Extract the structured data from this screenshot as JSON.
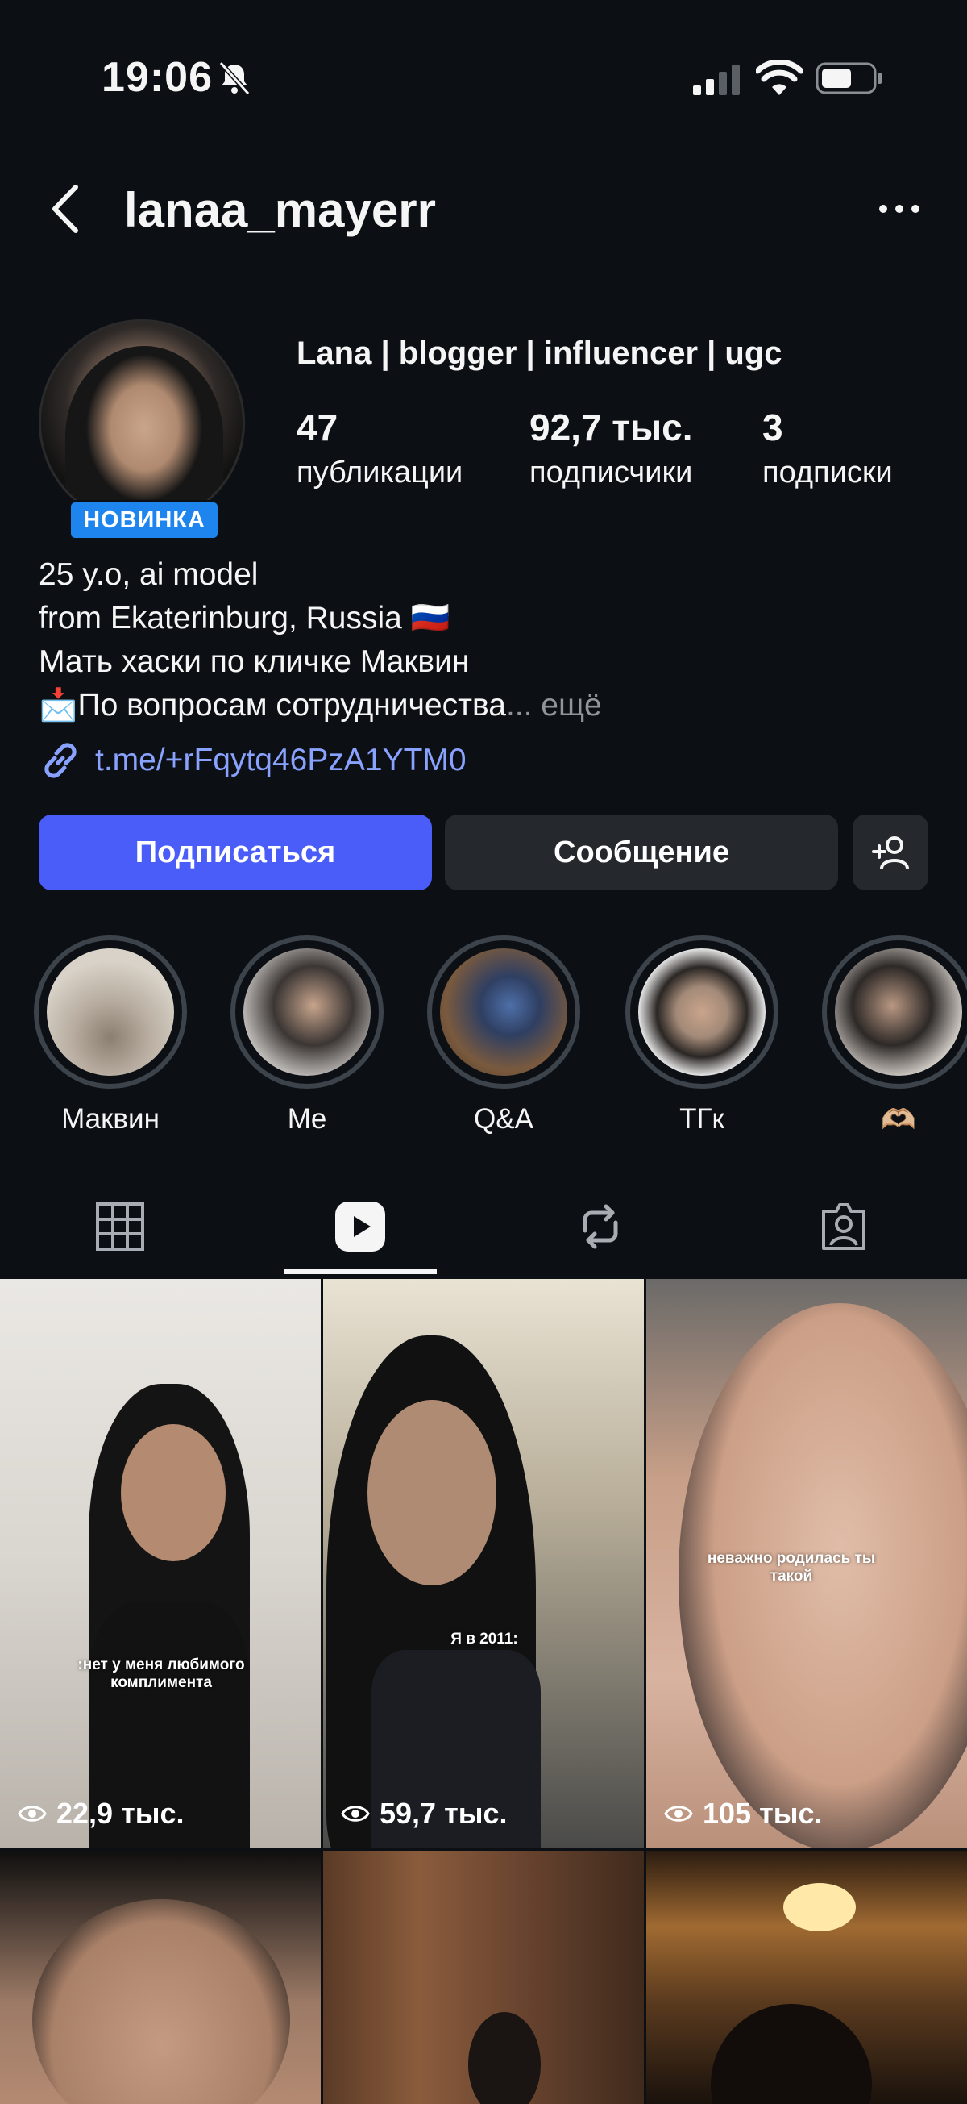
{
  "status_bar": {
    "time": "19:06"
  },
  "header": {
    "username": "lanaa_mayerr"
  },
  "profile": {
    "badge": "НОВИНКА",
    "display_name": "Lana | blogger | influencer | ugc",
    "stats": [
      {
        "value": "47",
        "label": "публикации"
      },
      {
        "value": "92,7 тыс.",
        "label": "подписчики"
      },
      {
        "value": "3",
        "label": "подписки"
      }
    ],
    "bio": {
      "line1": "25 y.o, ai model",
      "line2": "from Ekaterinburg, Russia 🇷🇺",
      "line3": "Мать хаски по кличке Маквин",
      "line4": "📩По вопросам сотрудничества",
      "more": "... ещё"
    },
    "link": "t.me/+rFqytq46PzA1YTM0"
  },
  "buttons": {
    "follow": "Подписаться",
    "message": "Сообщение"
  },
  "highlights": [
    {
      "label": "Маквин",
      "colors": [
        "#d8d2c8",
        "#8a7f70"
      ]
    },
    {
      "label": "Me",
      "colors": [
        "#c9c5c2",
        "#3b3634"
      ]
    },
    {
      "label": "Q&A",
      "colors": [
        "#4e6fa8",
        "#7a5a3e"
      ]
    },
    {
      "label": "ТГк",
      "colors": [
        "#f2f2f2",
        "#a38a78"
      ]
    },
    {
      "label": "🫶🏼",
      "colors": [
        "#dcd6d0",
        "#9f8a7c"
      ]
    }
  ],
  "tabs": [
    "grid-icon",
    "reels-icon",
    "reposts-icon",
    "tagged-icon"
  ],
  "reels": [
    {
      "views": "22,9 тыс.",
      "caption": ":нет у меня любимого комплимента"
    },
    {
      "views": "59,7 тыс.",
      "caption": "Я в 2011:"
    },
    {
      "views": "105 тыс.",
      "caption": "неважно родилась ты такой"
    },
    {
      "views": "",
      "caption": ""
    },
    {
      "views": "",
      "caption": ""
    },
    {
      "views": "",
      "caption": ""
    }
  ],
  "colors": {
    "background": "#0c1014",
    "follow_button": "#4a5df9",
    "secondary_button": "#25292e",
    "badge": "#1f85ee",
    "link": "#8aa2ff"
  }
}
